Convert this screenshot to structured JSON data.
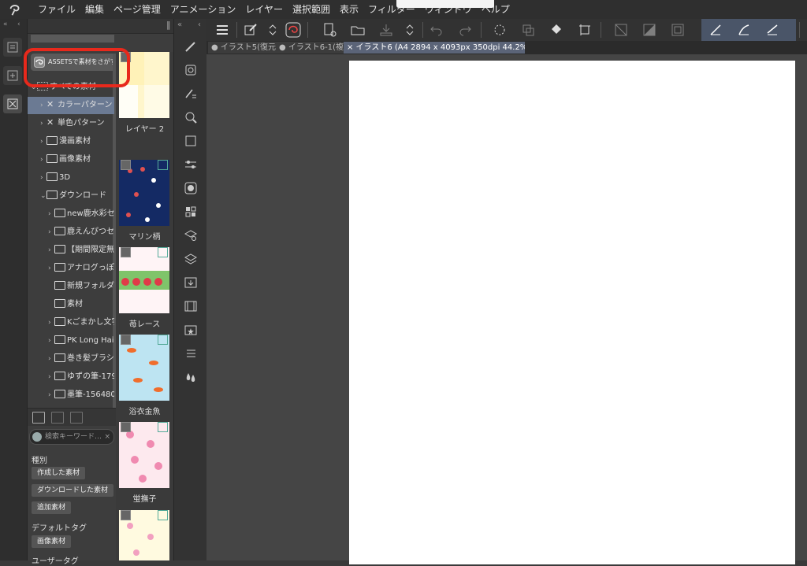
{
  "menu": {
    "items": [
      "ファイル",
      "編集",
      "ページ管理",
      "アニメーション",
      "レイヤー",
      "選択範囲",
      "表示",
      "フィルター",
      "ウィンドウ",
      "ヘルプ"
    ]
  },
  "material_panel": {
    "assets_button": "ASSETSで素材をさがす",
    "tree": [
      {
        "label": "すべての素材",
        "level": 0,
        "expanded": true,
        "icon": "grid-icon"
      },
      {
        "label": "カラーパターン",
        "level": 1,
        "expanded": false,
        "icon": "pattern-icon",
        "selected": true
      },
      {
        "label": "単色パターン",
        "level": 1,
        "expanded": false,
        "icon": "pattern-icon"
      },
      {
        "label": "漫画素材",
        "level": 1,
        "expanded": false,
        "icon": "manga-icon"
      },
      {
        "label": "画像素材",
        "level": 1,
        "expanded": false,
        "icon": "image-icon"
      },
      {
        "label": "3D",
        "level": 1,
        "expanded": false,
        "icon": "cube-icon"
      },
      {
        "label": "ダウンロード",
        "level": 1,
        "expanded": true,
        "icon": "download-folder-icon"
      },
      {
        "label": "new鹿水彩セ",
        "level": 2,
        "expanded": false,
        "icon": "folder-icon"
      },
      {
        "label": "鹿えんぴつセ",
        "level": 2,
        "expanded": false,
        "icon": "folder-icon"
      },
      {
        "label": "【期間限定無料",
        "level": 2,
        "expanded": false,
        "icon": "folder-icon"
      },
      {
        "label": "アナログっぽ",
        "level": 2,
        "expanded": false,
        "icon": "folder-icon"
      },
      {
        "label": "新規フォルダー",
        "level": 2,
        "expanded": null,
        "icon": "folder-icon"
      },
      {
        "label": "素材",
        "level": 2,
        "expanded": null,
        "icon": "folder-icon"
      },
      {
        "label": "Kごまかし文字",
        "level": 2,
        "expanded": false,
        "icon": "folder-icon"
      },
      {
        "label": "PK Long Hair",
        "level": 2,
        "expanded": false,
        "icon": "folder-icon"
      },
      {
        "label": "巻き髪ブラシ",
        "level": 2,
        "expanded": false,
        "icon": "folder-icon"
      },
      {
        "label": "ゆずの筆-179",
        "level": 2,
        "expanded": false,
        "icon": "folder-icon"
      },
      {
        "label": "墨筆-156480",
        "level": 2,
        "expanded": false,
        "icon": "folder-icon"
      }
    ],
    "thumbnails": [
      {
        "label": "レイヤー 2",
        "style": "cream-checker"
      },
      {
        "label": "マリン柄",
        "style": "navy-marine"
      },
      {
        "label": "苺レース",
        "style": "strawberry-lace"
      },
      {
        "label": "浴衣金魚",
        "style": "goldfish"
      },
      {
        "label": "蛍撫子",
        "style": "pink-floral"
      },
      {
        "label": "",
        "style": "yellow-floral"
      }
    ],
    "search": {
      "placeholder": "検索キーワード…"
    },
    "type_section": {
      "label": "種別",
      "tags": [
        "作成した素材",
        "ダウンロードした素材",
        "追加素材"
      ]
    },
    "default_tag_section": {
      "label": "デフォルトタグ",
      "tags": [
        "画像素材"
      ]
    },
    "user_tag_section": {
      "label": "ユーザータグ"
    }
  },
  "document_tabs": [
    {
      "label": "● イラスト5(復元",
      "active": false
    },
    {
      "label": "● イラスト6-1(複",
      "active": false
    },
    {
      "label": "× イラスト6 (A4 2894 x 4093px 350dpi 44.2%)",
      "active": true
    }
  ],
  "colors": {
    "highlight_ring": "#e8291c",
    "paper": "#ffffff",
    "selected_tree": "#6b7a93"
  }
}
